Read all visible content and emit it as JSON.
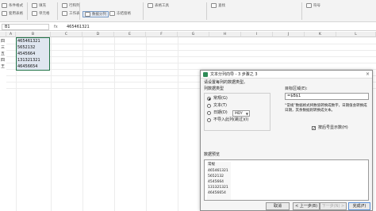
{
  "ribbon": {
    "buttons": [
      "条件格式",
      "套用表格",
      "填充",
      "单元格",
      "行和列",
      "工作表",
      "冻结窗格",
      "表格工具",
      "查找",
      "符号"
    ],
    "selected_button": "数据分列",
    "group_labels": [
      "常规",
      "求和",
      "筛选",
      "排序",
      "格式"
    ]
  },
  "formula_bar": {
    "name_box": "B1",
    "fx": "fx",
    "value": "465461321"
  },
  "grid": {
    "columns": [
      "",
      "A",
      "B",
      "C",
      "D",
      "E",
      "F",
      "G",
      "H",
      "I",
      "J",
      "K",
      "L",
      "M"
    ],
    "row_labels": [
      "四",
      "三",
      "五",
      "四",
      "王"
    ],
    "cells": [
      "465461321",
      "5652132",
      "4545664",
      "131321321",
      "46456654"
    ]
  },
  "dialog": {
    "title": "文本分列向导 - 3 步骤之 3",
    "close": "×",
    "instruction": "请设置每列的数据类型。",
    "column_type_label": "列数据类型",
    "options": [
      {
        "label": "常规(G)",
        "checked": true
      },
      {
        "label": "文本(T)",
        "checked": false
      },
      {
        "label": "日期(D)",
        "checked": false
      },
      {
        "label": "不导入此列(跳过)(I)",
        "checked": false
      }
    ],
    "date_format": "MDY",
    "target_label": "目标区域(E):",
    "target_value": "=$B$1",
    "description": "“常规”数据格式将数值转换成数字，日期值会转换成日期，其余数据则转换成文本。",
    "checkbox_label": "按后号显示数(H)",
    "preview_label": "数据预览",
    "preview": {
      "header": "常规",
      "rows": [
        "465461321",
        "5652132",
        "4545664",
        "131321321",
        "46456654"
      ]
    },
    "buttons": {
      "cancel": "取消",
      "prev": "< 上一步(B)",
      "next": "下一步(N) >",
      "finish": "完成(F)"
    }
  }
}
